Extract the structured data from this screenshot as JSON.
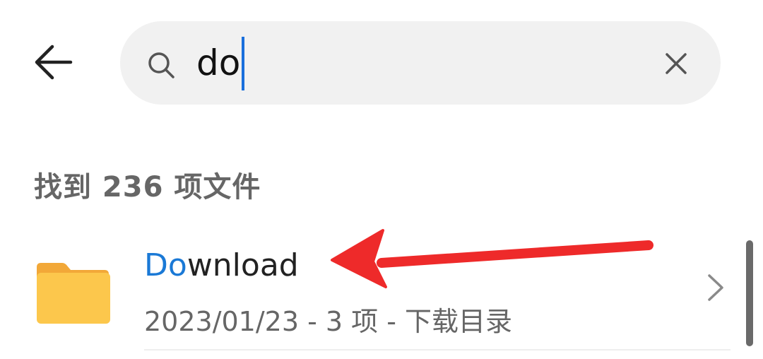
{
  "search": {
    "query": "do",
    "icon": "search-icon",
    "clear_icon": "close-icon"
  },
  "header": {
    "back_icon": "arrow-left-icon"
  },
  "results": {
    "count_text": "找到 236 项文件"
  },
  "items": [
    {
      "name_highlight": "Do",
      "name_rest": "wnload",
      "meta": "2023/01/23 - 3 项 - 下载目录",
      "icon": "folder-icon"
    }
  ],
  "colors": {
    "accent": "#1a79d6",
    "folder": "#fcc74c",
    "annotation_arrow": "#ee2a2a"
  }
}
